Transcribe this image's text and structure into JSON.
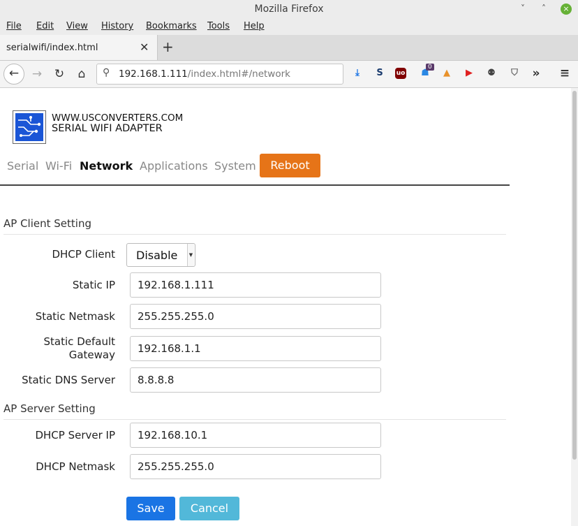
{
  "window": {
    "title": "Mozilla Firefox"
  },
  "menu": [
    "File",
    "Edit",
    "View",
    "History",
    "Bookmarks",
    "Tools",
    "Help"
  ],
  "tab": {
    "label": "serialwifi/index.html"
  },
  "url": {
    "host": "192.168.1.111",
    "path": "/index.html#/network"
  },
  "ext_badge": "0",
  "brand": {
    "line1": "WWW.USCONVERTERS.COM",
    "line2": "SERIAL WIFI ADAPTER"
  },
  "nav": {
    "items": [
      "Serial",
      "Wi-Fi",
      "Network",
      "Applications",
      "System"
    ],
    "active": "Network",
    "reboot": "Reboot"
  },
  "ap_client": {
    "title": "AP Client Setting",
    "dhcp_client_label": "DHCP Client",
    "dhcp_client_value": "Disable",
    "static_ip_label": "Static IP",
    "static_ip": "192.168.1.111",
    "netmask_label": "Static Netmask",
    "netmask": "255.255.255.0",
    "gateway_label_1": "Static Default",
    "gateway_label_2": "Gateway",
    "gateway": "192.168.1.1",
    "dns_label": "Static DNS Server",
    "dns": "8.8.8.8"
  },
  "ap_server": {
    "title": "AP Server Setting",
    "server_ip_label": "DHCP Server IP",
    "server_ip": "192.168.10.1",
    "server_netmask_label": "DHCP Netmask",
    "server_netmask": "255.255.255.0"
  },
  "actions": {
    "save": "Save",
    "cancel": "Cancel"
  },
  "colors": {
    "reboot": "#e67418",
    "save": "#1a74e4",
    "cancel": "#52b8d9",
    "logo": "#1a55d6"
  }
}
